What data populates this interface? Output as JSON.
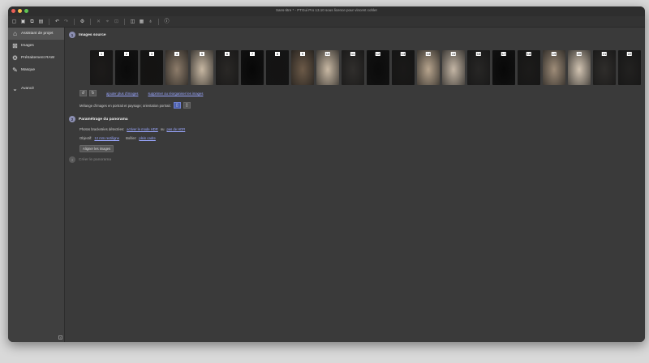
{
  "window": {
    "title": "Sans-titre * - PTGui Pro 13.10 sous licence pour vincent cohler"
  },
  "colors": {
    "red": "#ec5f56",
    "yellow": "#f4bd4f",
    "green": "#5fc553",
    "accent": "#8c8fb2",
    "link": "#9aa7ff"
  },
  "toolbar": {
    "icons": [
      "new-icon",
      "save-icon",
      "save-as-icon",
      "batch-icon",
      "undo-icon",
      "redo-icon",
      "settings-icon",
      "mask-icon",
      "control-points-icon",
      "crop-icon",
      "panorama-editor-icon",
      "table-icon",
      "bulb-icon",
      "info-icon"
    ]
  },
  "sidebar": {
    "items": [
      {
        "label": "Assistant de projet",
        "icon": "home-icon"
      },
      {
        "label": "Images",
        "icon": "images-icon"
      },
      {
        "label": "Prétraitement RAW",
        "icon": "raw-settings-icon"
      },
      {
        "label": "Masque",
        "icon": "brush-icon"
      }
    ],
    "advanced": {
      "label": "Avancé",
      "icon": "chevron-down-circle-icon"
    }
  },
  "steps": [
    {
      "num": "1",
      "title": "Images source"
    },
    {
      "num": "2",
      "title": "Paramétrage du panorama"
    },
    {
      "num": "3",
      "title": "Créer le panorama"
    }
  ],
  "thumbnails": [
    {
      "n": "1",
      "tone": "#1d1b1a"
    },
    {
      "n": "2",
      "tone": "#0a0a0a"
    },
    {
      "n": "3",
      "tone": "#141312"
    },
    {
      "n": "4",
      "tone": "#8d7c6a"
    },
    {
      "n": "5",
      "tone": "#c7b7a2"
    },
    {
      "n": "6",
      "tone": "#2a2826"
    },
    {
      "n": "7",
      "tone": "#070707"
    },
    {
      "n": "8",
      "tone": "#141313"
    },
    {
      "n": "9",
      "tone": "#6c5a48"
    },
    {
      "n": "10",
      "tone": "#c9b9a4"
    },
    {
      "n": "11",
      "tone": "#302e2c"
    },
    {
      "n": "12",
      "tone": "#0b0b0b"
    },
    {
      "n": "13",
      "tone": "#1a1918"
    },
    {
      "n": "14",
      "tone": "#b8a58e"
    },
    {
      "n": "15",
      "tone": "#c4b6a5"
    },
    {
      "n": "16",
      "tone": "#272625"
    },
    {
      "n": "17",
      "tone": "#080808"
    },
    {
      "n": "18",
      "tone": "#1c1b1a"
    },
    {
      "n": "19",
      "tone": "#9e8c78"
    },
    {
      "n": "20",
      "tone": "#d2c4b2"
    },
    {
      "n": "21",
      "tone": "#2f2d2b"
    },
    {
      "n": "22",
      "tone": "#222120"
    }
  ],
  "source": {
    "add_more": "ajouter plus d'images",
    "delete_rearrange": "supprimer ou réorganiser les images",
    "orientation_label": "Mélange d'images en portrait et paysage; orientation portrait:"
  },
  "setup": {
    "bracket_label": "Photos bracketées détectées:",
    "bracket_enable": "activer le mode HDR",
    "bracket_or": "ou",
    "bracket_no": "pas de HDR",
    "lens_label": "Objectif:",
    "lens_value": "12 mm rectiligne",
    "body_label": "Boîtier:",
    "body_value": "plein cadre",
    "align_button": "Aligner les images"
  }
}
